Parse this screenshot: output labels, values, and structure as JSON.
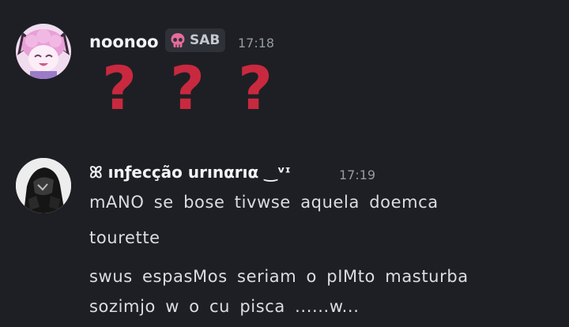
{
  "messages": [
    {
      "username": "noonoo",
      "tag": {
        "label": "SAB",
        "icon": "skull-icon",
        "color": "#e56b9a"
      },
      "timestamp": "17:18",
      "content": [
        "❓",
        "❓",
        "❓"
      ]
    },
    {
      "username": "ꕤ ınƒecção urınαrıα ‿ᵛᶦ",
      "timestamp": "17:19",
      "lines": [
        "mANO se bose tivwse aquela doemca",
        "tourette",
        "swus espasMos seriam o pIMto masturba",
        "sozimjo w o cu pisca ......w..."
      ]
    }
  ],
  "colors": {
    "background": "#1e1f24",
    "username": "#f2f3f5",
    "text": "#dbdee1",
    "timestamp": "#949ba4",
    "emoji_question": "#c8293f"
  }
}
